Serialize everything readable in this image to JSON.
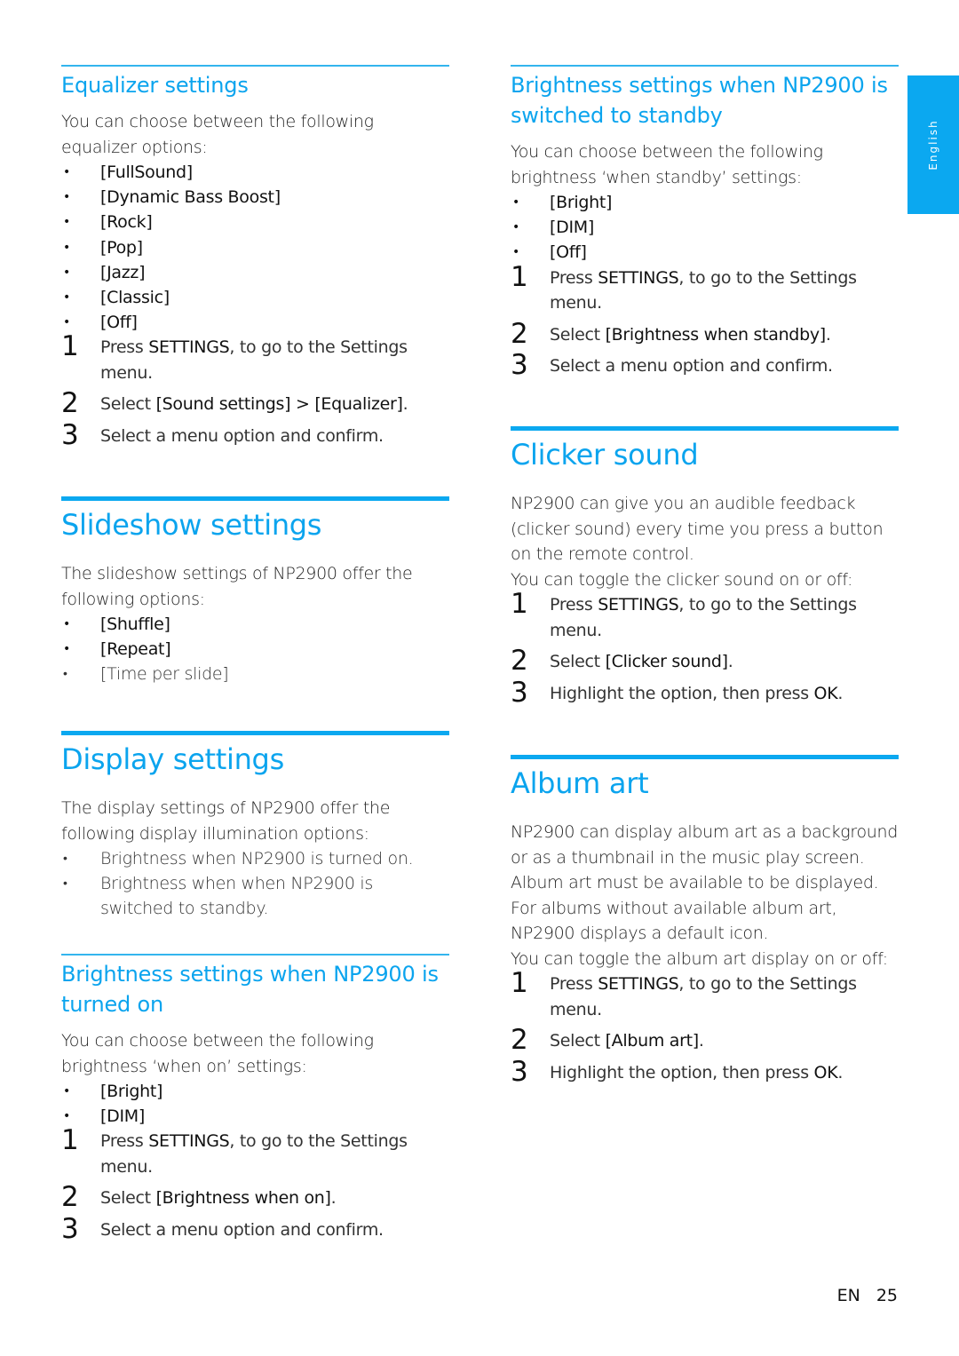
{
  "side_tab": {
    "label": "English"
  },
  "footer": {
    "lang": "EN",
    "page": "25"
  },
  "colors": {
    "accent": "#0ba4ee"
  },
  "left": {
    "equalizer": {
      "title": "Equalizer settings",
      "intro": "You can choose between the following equalizer options:",
      "options": [
        "[FullSound]",
        "[Dynamic Bass Boost]",
        "[Rock]",
        "[Pop]",
        "[Jazz]",
        "[Classic]",
        "[Off]"
      ],
      "steps": [
        {
          "num": "1",
          "pre": "Press ",
          "em": "SETTINGS",
          "post": ", to go to the Settings menu."
        },
        {
          "num": "2",
          "pre": "Select ",
          "em": "[Sound settings] > [Equalizer]",
          "post": "."
        },
        {
          "num": "3",
          "pre": "Select a menu option and confirm.",
          "em": "",
          "post": ""
        }
      ]
    },
    "slideshow": {
      "title": "Slideshow settings",
      "intro": "The slideshow settings of NP2900 offer the following options:",
      "options": [
        "[Shuffle]",
        "[Repeat]",
        "[Time per slide]"
      ]
    },
    "display": {
      "title": "Display settings",
      "intro": "The display settings of NP2900 offer the following display illumination options:",
      "options": [
        "Brightness when NP2900 is turned on.",
        "Brightness when when NP2900 is switched to standby."
      ]
    },
    "brightness_on": {
      "title": "Brightness settings when NP2900 is turned on",
      "intro": "You can choose between the following brightness ‘when on’ settings:",
      "options": [
        "[Bright]",
        "[DIM]"
      ],
      "steps": [
        {
          "num": "1",
          "pre": "Press ",
          "em": "SETTINGS",
          "post": ", to go to the Settings menu."
        },
        {
          "num": "2",
          "pre": "Select ",
          "em": "[Brightness when on]",
          "post": "."
        },
        {
          "num": "3",
          "pre": "Select a menu option and confirm.",
          "em": "",
          "post": ""
        }
      ]
    }
  },
  "right": {
    "brightness_standby": {
      "title": "Brightness settings when NP2900 is switched to standby",
      "intro": "You can choose between the following brightness ‘when standby’ settings:",
      "options": [
        "[Bright]",
        "[DIM]",
        "[Off]"
      ],
      "steps": [
        {
          "num": "1",
          "pre": "Press ",
          "em": "SETTINGS",
          "post": ", to go to the Settings menu."
        },
        {
          "num": "2",
          "pre": "Select ",
          "em": "[Brightness when standby]",
          "post": "."
        },
        {
          "num": "3",
          "pre": "Select a menu option and confirm.",
          "em": "",
          "post": ""
        }
      ]
    },
    "clicker": {
      "title": "Clicker sound",
      "intro": "NP2900 can give you an audible feedback (clicker sound) every time you press a button on the remote control.",
      "toggle": "You can toggle the clicker sound on or off:",
      "steps": [
        {
          "num": "1",
          "pre": "Press ",
          "em": "SETTINGS",
          "post": ", to go to the Settings menu."
        },
        {
          "num": "2",
          "pre": "Select ",
          "em": "[Clicker sound]",
          "post": "."
        },
        {
          "num": "3",
          "pre": "Highlight the option, then press ",
          "em": "OK",
          "post": "."
        }
      ]
    },
    "album_art": {
      "title": "Album art",
      "intro": "NP2900 can display album art as a background or as a thumbnail in the music play screen. Album art must be available to be displayed. For albums without available album art, NP2900 displays a default icon.",
      "toggle": "You can toggle the album art display on or off:",
      "steps": [
        {
          "num": "1",
          "pre": "Press ",
          "em": "SETTINGS",
          "post": ", to go to the Settings menu."
        },
        {
          "num": "2",
          "pre": "Select ",
          "em": "[Album art]",
          "post": "."
        },
        {
          "num": "3",
          "pre": "Highlight the option, then press ",
          "em": "OK",
          "post": "."
        }
      ]
    }
  }
}
